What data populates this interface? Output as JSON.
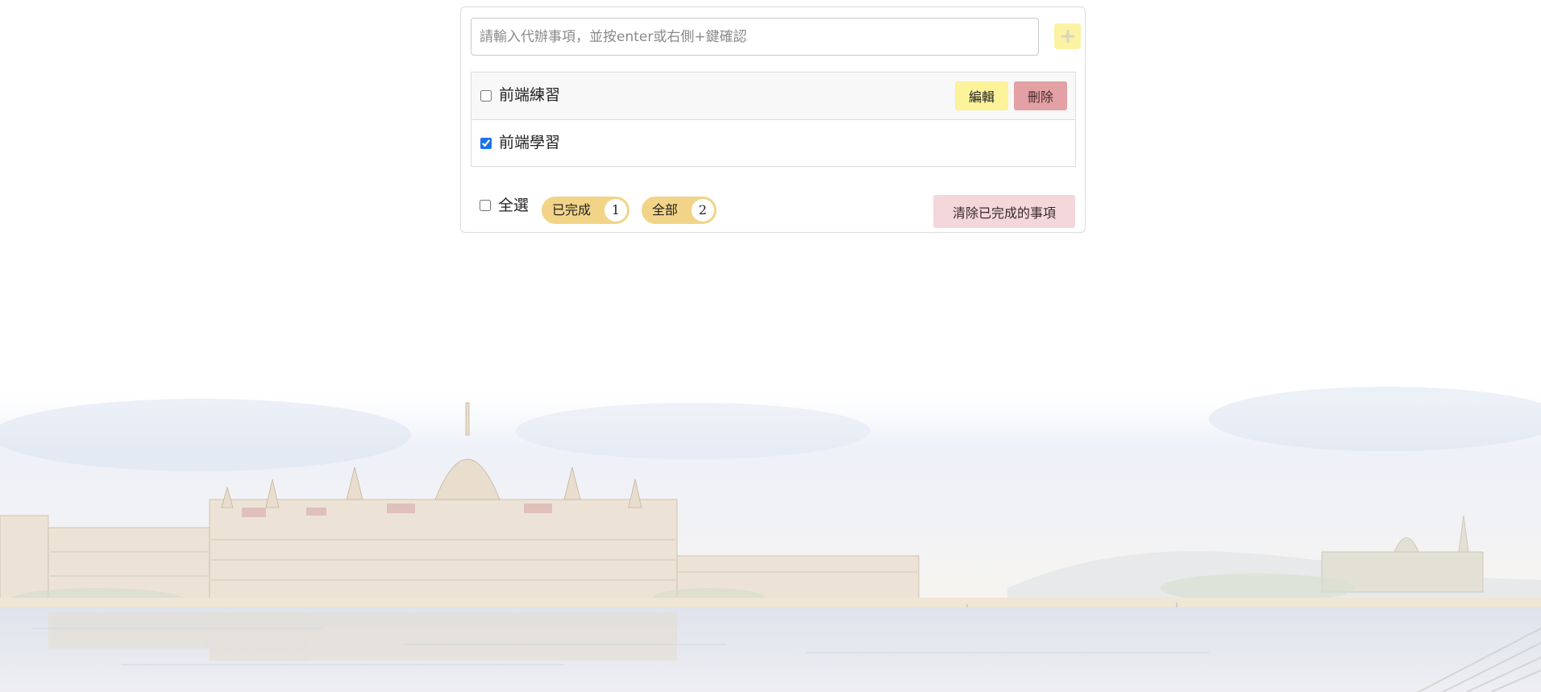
{
  "input": {
    "placeholder": "請輸入代辦事項，並按enter或右側+鍵確認",
    "value": ""
  },
  "add_button": {
    "icon": "plus-icon"
  },
  "todos": [
    {
      "text": "前端練習",
      "done": false,
      "edit_label": "編輯",
      "delete_label": "刪除"
    },
    {
      "text": "前端學習",
      "done": true
    }
  ],
  "footer": {
    "select_all_label": "全選",
    "filters": [
      {
        "label": "已完成",
        "count": "1"
      },
      {
        "label": "全部",
        "count": "2"
      }
    ],
    "clear_label": "清除已完成的事項"
  },
  "colors": {
    "accent_yellow": "#fbf29a",
    "delete_red": "#e3a1a5",
    "pill_gold": "#f2d488",
    "clear_pink": "#f4d7da"
  }
}
